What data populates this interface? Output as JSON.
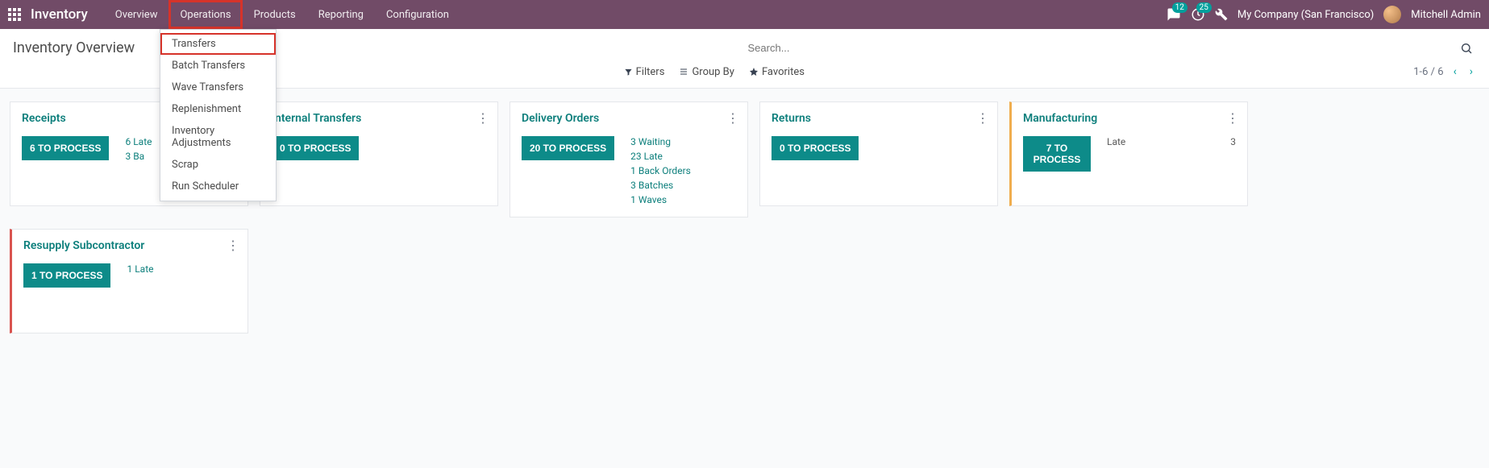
{
  "topnav": {
    "brand": "Inventory",
    "menu": [
      "Overview",
      "Operations",
      "Products",
      "Reporting",
      "Configuration"
    ],
    "chat_count": "12",
    "clock_count": "25",
    "company": "My Company (San Francisco)",
    "user": "Mitchell Admin"
  },
  "dropdown": {
    "items": [
      "Transfers",
      "Batch Transfers",
      "Wave Transfers",
      "Replenishment",
      "Inventory Adjustments",
      "Scrap",
      "Run Scheduler"
    ]
  },
  "control": {
    "title": "Inventory Overview",
    "search_placeholder": "Search...",
    "filters": "Filters",
    "groupby": "Group By",
    "favorites": "Favorites",
    "pager": "1-6 / 6"
  },
  "cards": [
    {
      "title": "Receipts",
      "button": "6 TO PROCESS",
      "border": "plain",
      "stats": [
        {
          "text": "6 Late",
          "type": "link"
        },
        {
          "text": "3 Ba",
          "type": "link"
        }
      ]
    },
    {
      "title": "Internal Transfers",
      "button": "0 TO PROCESS",
      "border": "plain",
      "stats": []
    },
    {
      "title": "Delivery Orders",
      "button": "20 TO PROCESS",
      "border": "plain",
      "stats": [
        {
          "text": "3 Waiting",
          "type": "link"
        },
        {
          "text": "23 Late",
          "type": "link"
        },
        {
          "text": "1 Back Orders",
          "type": "link"
        },
        {
          "text": "3 Batches",
          "type": "link"
        },
        {
          "text": "1 Waves",
          "type": "link"
        }
      ]
    },
    {
      "title": "Returns",
      "button": "0 TO PROCESS",
      "border": "plain",
      "stats": []
    },
    {
      "title": "Manufacturing",
      "button": "7 TO PROCESS",
      "border": "yellow",
      "stats": [
        {
          "text": "Late",
          "count": "3",
          "type": "late"
        }
      ]
    },
    {
      "title": "Resupply Subcontractor",
      "button": "1 TO PROCESS",
      "border": "red",
      "stats": [
        {
          "text": "1 Late",
          "type": "link"
        }
      ]
    }
  ]
}
